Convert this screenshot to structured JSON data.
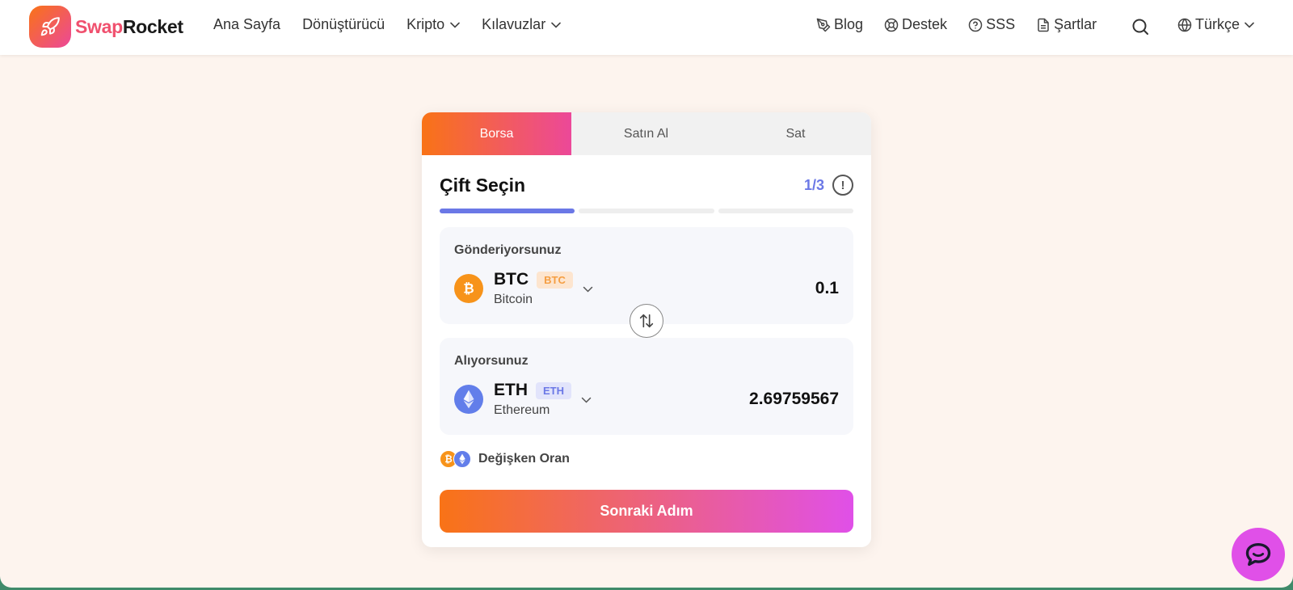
{
  "brand": {
    "part1": "Swap",
    "part2": "Rocket"
  },
  "nav": {
    "home": "Ana Sayfa",
    "converter": "Dönüştürücü",
    "crypto": "Kripto",
    "guides": "Kılavuzlar"
  },
  "right_nav": {
    "blog": "Blog",
    "support": "Destek",
    "faq": "SSS",
    "terms": "Şartlar"
  },
  "language": "Türkçe",
  "tabs": {
    "exchange": "Borsa",
    "buy": "Satın Al",
    "sell": "Sat"
  },
  "card": {
    "title": "Çift Seçin",
    "step": "1/3",
    "progress_steps_completed": 1,
    "progress_steps_total": 3
  },
  "send": {
    "label": "Gönderiyorsunuz",
    "symbol": "BTC",
    "badge": "BTC",
    "name": "Bitcoin",
    "amount": "0.1"
  },
  "receive": {
    "label": "Alıyorsunuz",
    "symbol": "ETH",
    "badge": "ETH",
    "name": "Ethereum",
    "amount": "2.69759567"
  },
  "rate": {
    "label": "Değişken Oran"
  },
  "next_button": "Sonraki Adım",
  "colors": {
    "accent_start": "#f97316",
    "accent_end": "#ec4899",
    "step_color": "#6b78e6",
    "btc": "#f7931a",
    "eth": "#627eea",
    "background": "#fdf4ee"
  },
  "icons": {
    "logo": "rocket-icon",
    "blog": "pen-icon",
    "support": "lifebuoy-icon",
    "faq": "question-icon",
    "terms": "document-icon",
    "search": "search-icon",
    "language": "globe-icon",
    "swap": "swap-arrows-icon",
    "chat": "chat-icon"
  }
}
